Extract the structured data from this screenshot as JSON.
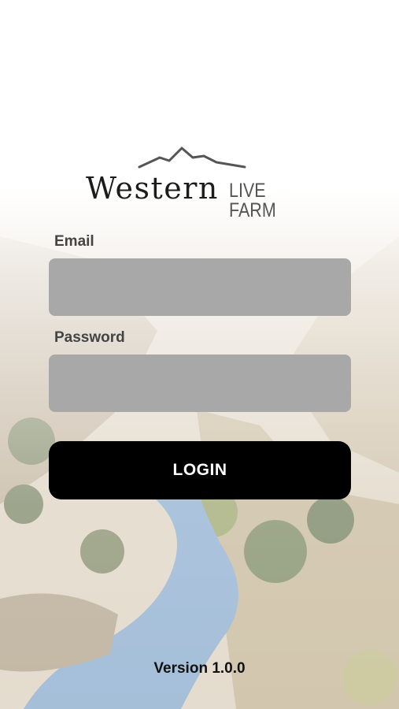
{
  "brand": {
    "name": "Western",
    "subtitle": "LIVE FARM"
  },
  "form": {
    "email_label": "Email",
    "email_value": "",
    "password_label": "Password",
    "password_value": "",
    "login_label": "LOGIN"
  },
  "footer": {
    "version": "Version 1.0.0"
  },
  "colors": {
    "input_bg": "#a8a8a8",
    "button_bg": "#000000",
    "button_text": "#ffffff",
    "river": "#7fa3c9"
  }
}
